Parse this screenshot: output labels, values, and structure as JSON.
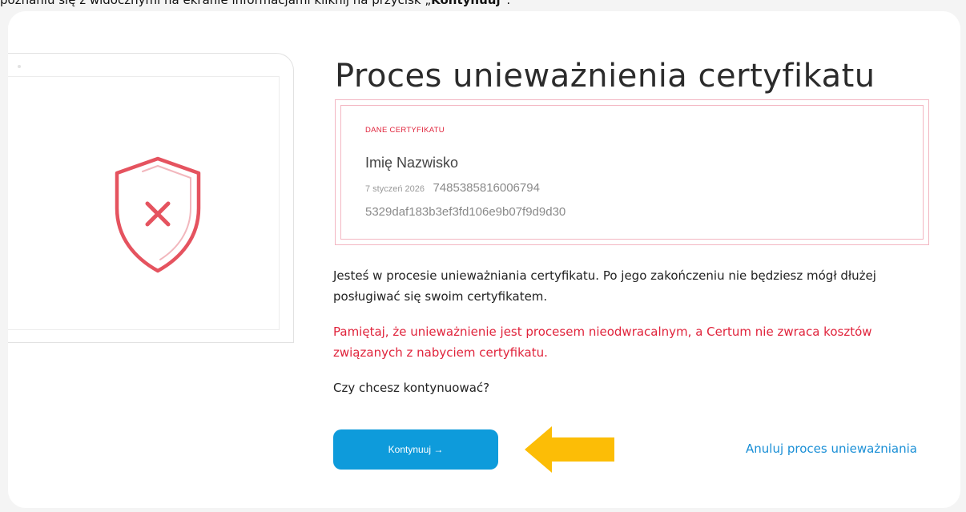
{
  "caption": {
    "prefix": "poznaniu się z widocznymi na ekranie informacjami kliknij na przycisk „",
    "highlight": "Kontynuuj",
    "suffix": "”."
  },
  "title": "Proces unieważnienia certyfikatu",
  "certificate": {
    "label": "DANE CERTYFIKATU",
    "name": "Imię Nazwisko",
    "date": "7 styczeń 2026",
    "serial": "7485385816006794",
    "hash": "5329daf183b3ef3fd106e9b07f9d9d30"
  },
  "message": {
    "info": "Jesteś w procesie unieważniania certyfikatu. Po jego zakończeniu nie będziesz mógł dłużej posługiwać się swoim certyfikatem.",
    "warning": "Pamiętaj, że unieważnienie jest procesem nieodwracalnym, a Certum nie zwraca kosztów związanych z nabyciem certyfikatu.",
    "question": "Czy chcesz kontynuować?"
  },
  "actions": {
    "continue_label": "Kontynuuj →",
    "cancel_label": "Anuluj proces unieważniania"
  },
  "icons": {
    "illustration": "shield-x-icon",
    "pointer": "arrow-left-icon"
  },
  "colors": {
    "accent_blue": "#0e9bdb",
    "warning_red": "#e0243c",
    "shield_red": "#e5535f",
    "arrow_yellow": "#fcbd06"
  }
}
